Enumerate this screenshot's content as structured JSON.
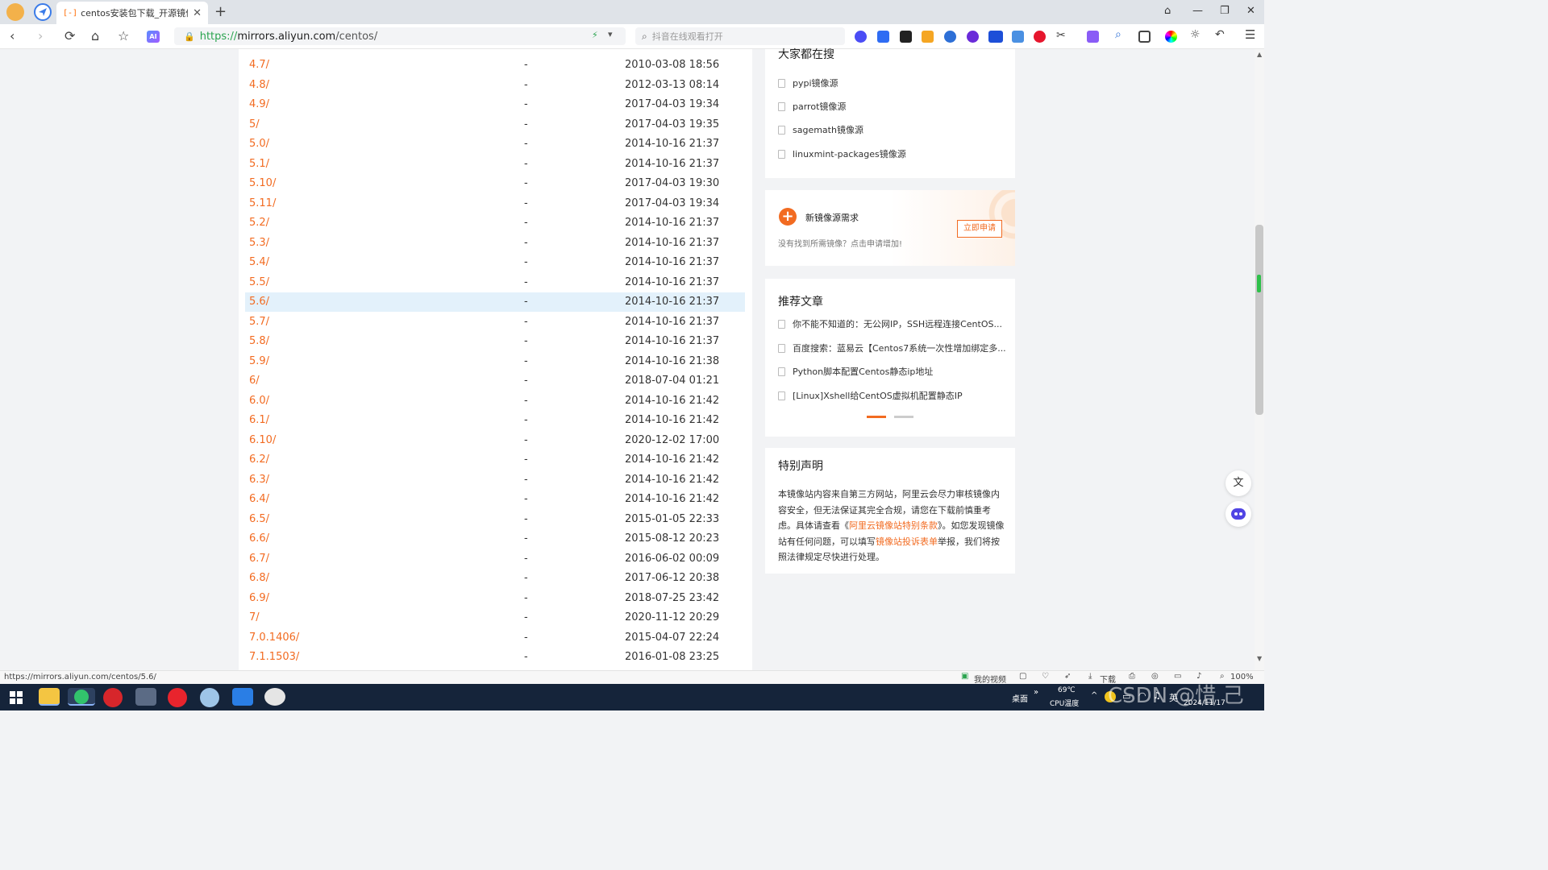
{
  "browser": {
    "tab_title": "centos安装包下载_开源镜像站-",
    "tab_favicon": "[-]",
    "url_protocol": "https://",
    "url_host": "mirrors.aliyun.com",
    "url_path": "/centos/",
    "search_placeholder": "抖音在线观看打开",
    "ai_label": "AI"
  },
  "listing": {
    "highlight_index": 12,
    "rows": [
      {
        "name": "4.7/",
        "size": "-",
        "date": "2010-03-08 18:56"
      },
      {
        "name": "4.8/",
        "size": "-",
        "date": "2012-03-13 08:14"
      },
      {
        "name": "4.9/",
        "size": "-",
        "date": "2017-04-03 19:34"
      },
      {
        "name": "5/",
        "size": "-",
        "date": "2017-04-03 19:35"
      },
      {
        "name": "5.0/",
        "size": "-",
        "date": "2014-10-16 21:37"
      },
      {
        "name": "5.1/",
        "size": "-",
        "date": "2014-10-16 21:37"
      },
      {
        "name": "5.10/",
        "size": "-",
        "date": "2017-04-03 19:30"
      },
      {
        "name": "5.11/",
        "size": "-",
        "date": "2017-04-03 19:34"
      },
      {
        "name": "5.2/",
        "size": "-",
        "date": "2014-10-16 21:37"
      },
      {
        "name": "5.3/",
        "size": "-",
        "date": "2014-10-16 21:37"
      },
      {
        "name": "5.4/",
        "size": "-",
        "date": "2014-10-16 21:37"
      },
      {
        "name": "5.5/",
        "size": "-",
        "date": "2014-10-16 21:37"
      },
      {
        "name": "5.6/",
        "size": "-",
        "date": "2014-10-16 21:37"
      },
      {
        "name": "5.7/",
        "size": "-",
        "date": "2014-10-16 21:37"
      },
      {
        "name": "5.8/",
        "size": "-",
        "date": "2014-10-16 21:37"
      },
      {
        "name": "5.9/",
        "size": "-",
        "date": "2014-10-16 21:38"
      },
      {
        "name": "6/",
        "size": "-",
        "date": "2018-07-04 01:21"
      },
      {
        "name": "6.0/",
        "size": "-",
        "date": "2014-10-16 21:42"
      },
      {
        "name": "6.1/",
        "size": "-",
        "date": "2014-10-16 21:42"
      },
      {
        "name": "6.10/",
        "size": "-",
        "date": "2020-12-02 17:00"
      },
      {
        "name": "6.2/",
        "size": "-",
        "date": "2014-10-16 21:42"
      },
      {
        "name": "6.3/",
        "size": "-",
        "date": "2014-10-16 21:42"
      },
      {
        "name": "6.4/",
        "size": "-",
        "date": "2014-10-16 21:42"
      },
      {
        "name": "6.5/",
        "size": "-",
        "date": "2015-01-05 22:33"
      },
      {
        "name": "6.6/",
        "size": "-",
        "date": "2015-08-12 20:23"
      },
      {
        "name": "6.7/",
        "size": "-",
        "date": "2016-06-02 00:09"
      },
      {
        "name": "6.8/",
        "size": "-",
        "date": "2017-06-12 20:38"
      },
      {
        "name": "6.9/",
        "size": "-",
        "date": "2018-07-25 23:42"
      },
      {
        "name": "7/",
        "size": "-",
        "date": "2020-11-12 20:29"
      },
      {
        "name": "7.0.1406/",
        "size": "-",
        "date": "2015-04-07 22:24"
      },
      {
        "name": "7.1.1503/",
        "size": "-",
        "date": "2016-01-08 23:25"
      }
    ]
  },
  "sidebar": {
    "popular": {
      "title": "大家都在搜",
      "items": [
        "pypi镜像源",
        "parrot镜像源",
        "sagemath镜像源",
        "linuxmint-packages镜像源"
      ]
    },
    "request": {
      "title": "新镜像源需求",
      "subtitle": "没有找到所需镜像？点击申请增加!",
      "button": "立即申请"
    },
    "articles": {
      "title": "推荐文章",
      "items": [
        "你不能不知道的：无公网IP，SSH远程连接CentOS...",
        "百度搜索：蓝易云【Centos7系统一次性增加绑定多...",
        "Python脚本配置Centos静态ip地址",
        "[Linux]Xshell给CentOS虚拟机配置静态IP"
      ]
    },
    "notice": {
      "title": "特别声明",
      "text_1": "本镜像站内容来自第三方网站，阿里云会尽力审核镜像内容安全，但无法保证其完全合规，请您在下载前慎重考虑。具体请查看《",
      "link_1": "阿里云镜像站特别条款",
      "text_2": "》。如您发现镜像站有任何问题，可以填写",
      "link_2": "镜像站投诉表单",
      "text_3": "举报，我们将按照法律规定尽快进行处理。"
    }
  },
  "statusbar": {
    "link_url": "https://mirrors.aliyun.com/centos/5.6/",
    "my_video": "我的视频",
    "download": "下载",
    "zoom": "100%"
  },
  "taskbar": {
    "desktop": "桌面",
    "cpu_temp": "69℃",
    "cpu_label": "CPU温度",
    "ime": "英",
    "date": "2024/11/17",
    "watermark": "CSDN @惜 己"
  },
  "colors": {
    "accent": "#f26b21",
    "row_highlight": "#e3f1fb",
    "taskbar": "#15243a"
  }
}
